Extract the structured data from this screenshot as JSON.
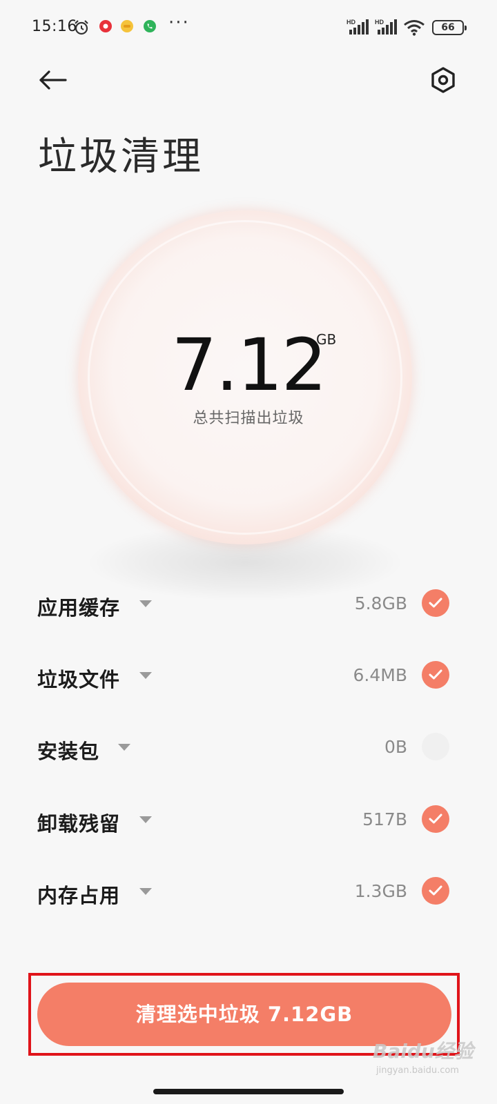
{
  "status_bar": {
    "time": "15:16",
    "battery": "66",
    "icons": [
      "alarm-icon",
      "red-app-icon",
      "yellow-app-icon",
      "green-phone-icon",
      "more-dots-icon",
      "hd-signal-icon",
      "hd-signal-icon",
      "wifi-icon",
      "battery-icon"
    ],
    "more": "···",
    "hd1": "HD",
    "hd2": "HD"
  },
  "header": {
    "title": "垃圾清理",
    "back_icon": "arrow-left-icon",
    "settings_icon": "hexagon-gear-icon"
  },
  "summary": {
    "value": "7.12",
    "unit": "GB",
    "caption": "总共扫描出垃圾"
  },
  "items": [
    {
      "label": "应用缓存",
      "size": "5.8GB",
      "checked": true
    },
    {
      "label": "垃圾文件",
      "size": "6.4MB",
      "checked": true
    },
    {
      "label": "安装包",
      "size": "0B",
      "checked": false
    },
    {
      "label": "卸载残留",
      "size": "517B",
      "checked": true
    },
    {
      "label": "内存占用",
      "size": "1.3GB",
      "checked": true
    }
  ],
  "action": {
    "button_label": "清理选中垃圾 7.12GB"
  },
  "watermark": {
    "text": "Baidu经验",
    "sub": "jingyan.baidu.com"
  },
  "colors": {
    "accent": "#f47e67",
    "highlight": "#e0141a",
    "background": "#f7f7f7"
  }
}
